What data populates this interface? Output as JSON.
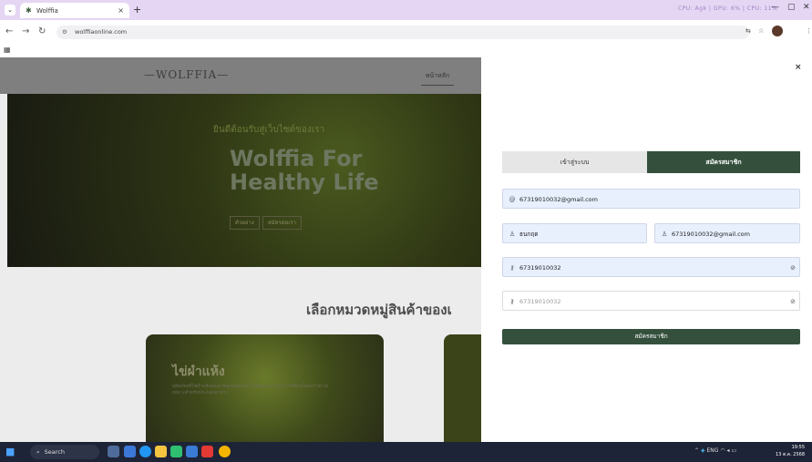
{
  "browser": {
    "tab_title": "Wolffia",
    "tab_close": "×",
    "new_tab": "+",
    "stats": "CPU: Agk  |  GPU: 6%  |  CPU: 11%",
    "url": "wolffiaonline.com",
    "win_min": "—",
    "win_max": "▢",
    "win_close": "✕",
    "apps_icon": "grid-icon"
  },
  "site": {
    "logo": "—WOLFFIA—",
    "nav_home": "หน้าหลัก",
    "hero_welcome": "ยินดีต้อนรับสู่เว็บไซต์ของเรา",
    "hero_title_1": "Wolffia For",
    "hero_title_2": "Healthy Life",
    "hero_btn_1": "ตัวอย่าง",
    "hero_btn_2": "สมัครต่อเรา",
    "section_title": "เลือกหมวดหมู่สินค้าของเ",
    "card_title": "ไข่ผำแห้ง",
    "card_desc": "ผลิตภัณฑ์ไข่ผำแห้งคุณภาพสูงอุดมด้วยโปรตีนและสารอาหารที่จำเป็นต่อร่างกาย เหมาะสำหรับประกอบอาหาร"
  },
  "panel": {
    "close": "×",
    "tab_login": "เข้าสู่ระบบ",
    "tab_register": "สมัครสมาชิก",
    "email_value": "67319010032@gmail.com",
    "name_value": "ธนกฤต",
    "username_value": "67319010032@gmail.com",
    "password_value": "67319010032",
    "confirm_placeholder": "67319010032",
    "submit": "สมัครสมาชิก"
  },
  "taskbar": {
    "search": "Search",
    "lang": "ENG",
    "time": "19:55",
    "date": "13 ต.ค. 2568"
  }
}
